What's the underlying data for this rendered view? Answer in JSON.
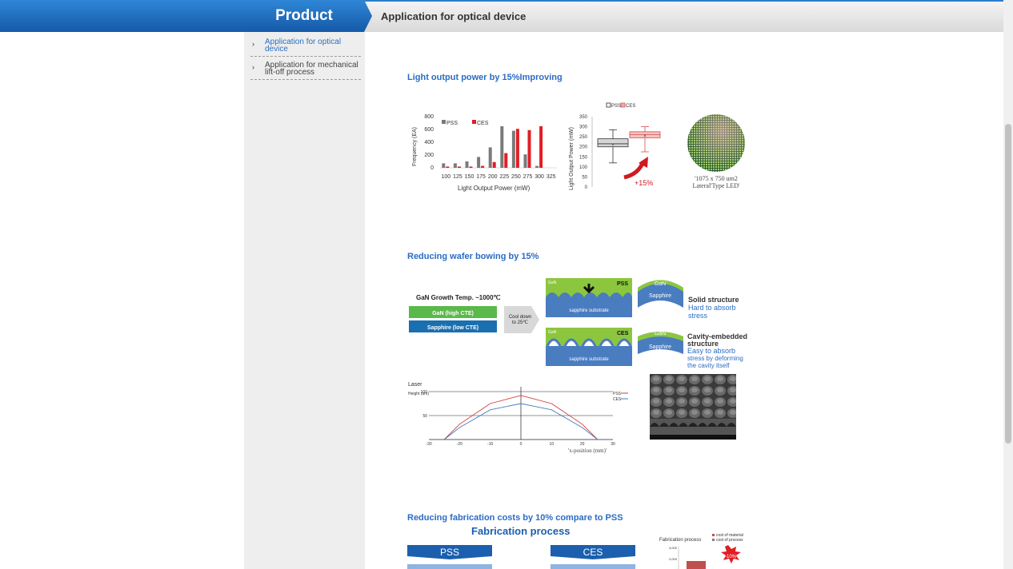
{
  "header": {
    "product_title": "Product",
    "page_heading": "Application for optical device"
  },
  "sidebar": {
    "items": [
      {
        "label": "Application for optical device",
        "active": true
      },
      {
        "label": "Application for mechanical lift-off process",
        "active": false
      }
    ]
  },
  "sections": {
    "s1_title": "Light output power by 15%Improving",
    "s2_title": "Reducing wafer bowing by 15%",
    "s3_title": "Reducing fabrication costs by 10% compare to PSS"
  },
  "chart_data": [
    {
      "type": "bar",
      "categories": [
        "100",
        "125",
        "150",
        "175",
        "200",
        "225",
        "250",
        "275",
        "300",
        "325"
      ],
      "series": [
        {
          "name": "PSS",
          "values": [
            70,
            70,
            100,
            170,
            320,
            650,
            580,
            210,
            30,
            0
          ]
        },
        {
          "name": "CES",
          "values": [
            20,
            20,
            20,
            30,
            90,
            230,
            610,
            590,
            650,
            0
          ]
        }
      ],
      "xlabel": "Light Output Power (mW)",
      "ylabel": "Frequency (EA)",
      "yticks": [
        0,
        200,
        400,
        600,
        800
      ],
      "ylim": [
        0,
        800
      ],
      "legend": "top-left"
    },
    {
      "type": "box",
      "series": [
        {
          "name": "PSS",
          "q1": 200,
          "median": 215,
          "q3": 240,
          "whisker_low": 120,
          "whisker_high": 285,
          "mean": 210
        },
        {
          "name": "CES",
          "q1": 245,
          "median": 260,
          "q3": 275,
          "whisker_low": 175,
          "whisker_high": 300,
          "mean": 255
        }
      ],
      "ylabel": "Light Output Power (mW)",
      "yticks": [
        0,
        50,
        100,
        150,
        200,
        250,
        300,
        350
      ],
      "ylim": [
        0,
        350
      ],
      "annotation": "+15%",
      "legend": "top"
    },
    {
      "type": "line",
      "series": [
        {
          "name": "PSS",
          "x": [
            -25,
            -20,
            -10,
            0,
            10,
            20,
            25
          ],
          "y": [
            0,
            32,
            75,
            92,
            75,
            32,
            0
          ]
        },
        {
          "name": "CES",
          "x": [
            -25,
            -20,
            -10,
            0,
            10,
            20,
            25
          ],
          "y": [
            0,
            25,
            62,
            75,
            62,
            25,
            0
          ]
        }
      ],
      "xticks": [
        -30,
        -20,
        -10,
        0,
        10,
        20,
        30
      ],
      "yticks": [
        50,
        100
      ],
      "xlim": [
        -30,
        30
      ],
      "ylim": [
        0,
        110
      ],
      "ylabel_top": "Laser",
      "ylabel": "Height (um)",
      "xlabel": "'x-position (mm)'"
    },
    {
      "type": "bar",
      "title": "Fabrication process",
      "legend_entries": [
        "cost of material",
        "cost of process"
      ],
      "yticks": [
        "3,000",
        "3,000"
      ],
      "annotation": "-10%"
    }
  ],
  "led": {
    "caption_1": "'1075 x 750 um2",
    "caption_2": "Lateral'Type LED'"
  },
  "bowing": {
    "growth_temp": "GaN Growth Temp. ~1000℃",
    "gan_high": "GaN (high CTE)",
    "sapphire_low": "Sapphire (low CTE)",
    "cool_down_1": "Cool down",
    "cool_down_2": "to 25℃",
    "gan": "GaN",
    "pss": "PSS",
    "ces": "CES",
    "sapphire_substrate": "sapphire substrate",
    "sapphire": "Sapphire",
    "solid_title": "Solid structure",
    "solid_d1": "Hard to absorb",
    "solid_d2": "stress",
    "cavity_t1": "Cavity-embedded",
    "cavity_t2": "structure",
    "cavity_d1": "Easy to absorb",
    "cavity_d2": "stress by deforming",
    "cavity_d3": "the cavity itself"
  },
  "fabrication": {
    "heading": "Fabrication process",
    "pss_label": "PSS",
    "ces_label": "CES"
  },
  "colors": {
    "brand_blue": "#1b5fae",
    "accent_text": "#2b6cc4",
    "ces_red": "#e01e25",
    "pss_gray": "#7a7a7a",
    "gan_green": "#8cc63f",
    "sapphire_blue": "#4a7cc0"
  }
}
